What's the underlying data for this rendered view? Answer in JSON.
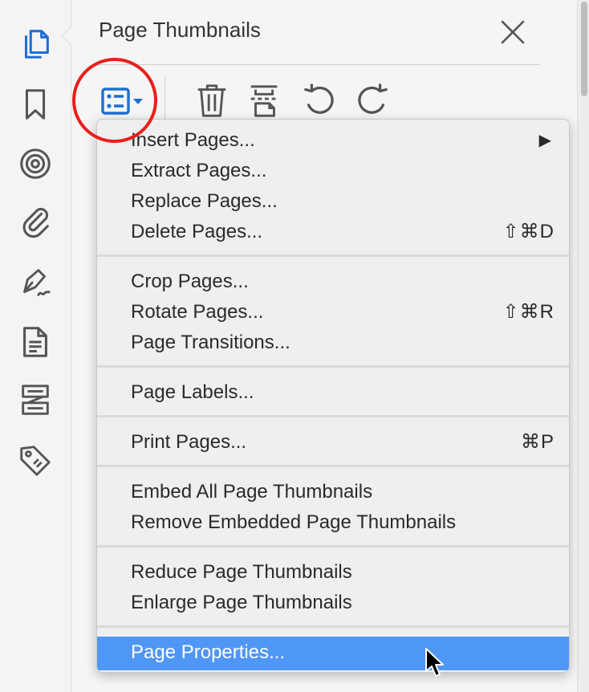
{
  "panel": {
    "title": "Page Thumbnails"
  },
  "rail": {
    "items": [
      {
        "icon": "page-thumbnails-icon",
        "active": true
      },
      {
        "icon": "bookmark-icon"
      },
      {
        "icon": "layers-icon"
      },
      {
        "icon": "attachment-icon"
      },
      {
        "icon": "signature-icon"
      },
      {
        "icon": "document-icon"
      },
      {
        "icon": "content-icon"
      },
      {
        "icon": "tag-icon"
      }
    ]
  },
  "toolbar": {
    "buttons": [
      "options-menu-icon",
      "trash-icon",
      "crop-page-icon",
      "rotate-counterclockwise-icon",
      "rotate-clockwise-icon"
    ]
  },
  "menu": {
    "groups": [
      [
        {
          "label": "Insert Pages...",
          "submenu": "▶"
        },
        {
          "label": "Extract Pages..."
        },
        {
          "label": "Replace Pages..."
        },
        {
          "label": "Delete Pages...",
          "shortcut": "⇧⌘D"
        }
      ],
      [
        {
          "label": "Crop Pages..."
        },
        {
          "label": "Rotate Pages...",
          "shortcut": "⇧⌘R"
        },
        {
          "label": "Page Transitions..."
        }
      ],
      [
        {
          "label": "Page Labels..."
        }
      ],
      [
        {
          "label": "Print Pages...",
          "shortcut": "⌘P"
        }
      ],
      [
        {
          "label": "Embed All Page Thumbnails"
        },
        {
          "label": "Remove Embedded Page Thumbnails"
        }
      ],
      [
        {
          "label": "Reduce Page Thumbnails"
        },
        {
          "label": "Enlarge Page Thumbnails"
        }
      ],
      [
        {
          "label": "Page Properties...",
          "selected": true
        }
      ]
    ]
  },
  "colors": {
    "accent_blue": "#1f6fd0",
    "highlight_red": "#e8201c",
    "selection": "#4f97f4",
    "icon_gray": "#555555"
  }
}
